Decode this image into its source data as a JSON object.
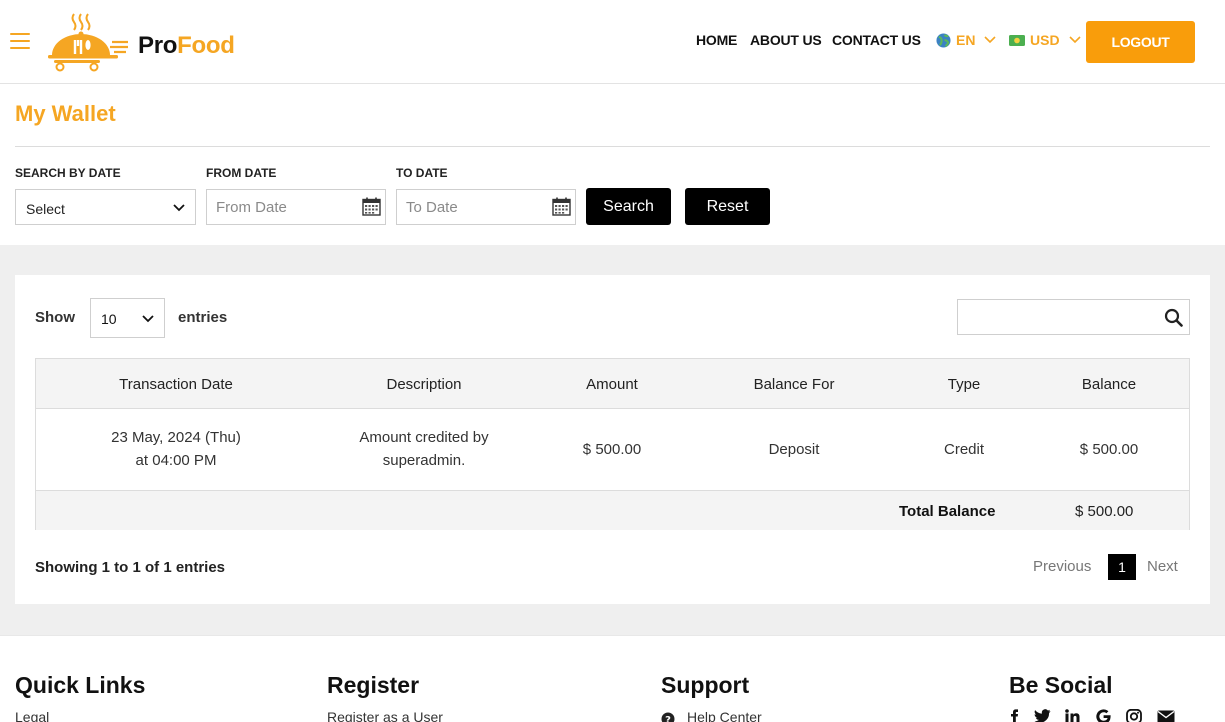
{
  "brand": {
    "pro": "Pro",
    "food": "Food"
  },
  "nav": {
    "home": "HOME",
    "about": "ABOUT US",
    "contact": "CONTACT US",
    "language": "EN",
    "currency": "USD",
    "logout": "LOGOUT"
  },
  "colors": {
    "accent": "#f5a623",
    "button_orange": "#f99d0b",
    "dark": "#000000"
  },
  "page": {
    "title": "My Wallet"
  },
  "filters": {
    "search_by_date_label": "SEARCH BY DATE",
    "search_by_date_value": "Select",
    "from_date_label": "FROM DATE",
    "from_date_placeholder": "From Date",
    "to_date_label": "TO DATE",
    "to_date_placeholder": "To Date",
    "search_button": "Search",
    "reset_button": "Reset"
  },
  "table_controls": {
    "show": "Show",
    "entries_value": "10",
    "entries": "entries"
  },
  "table": {
    "headers": [
      "Transaction Date",
      "Description",
      "Amount",
      "Balance For",
      "Type",
      "Balance"
    ],
    "rows": [
      {
        "date_line1": "23 May, 2024 (Thu)",
        "date_line2": "at 04:00 PM",
        "desc_line1": "Amount credited by",
        "desc_line2": "superadmin.",
        "amount": "$ 500.00",
        "balance_for": "Deposit",
        "type": "Credit",
        "balance": "$ 500.00"
      }
    ],
    "total_label": "Total Balance",
    "total_value": "$ 500.00"
  },
  "pagination": {
    "info": "Showing 1 to 1 of 1 entries",
    "previous": "Previous",
    "current": "1",
    "next": "Next"
  },
  "footer": {
    "quick_links": {
      "title": "Quick Links",
      "first": "Legal"
    },
    "register": {
      "title": "Register",
      "first": "Register as a User"
    },
    "support": {
      "title": "Support",
      "first": "Help Center"
    },
    "social": {
      "title": "Be Social"
    }
  }
}
